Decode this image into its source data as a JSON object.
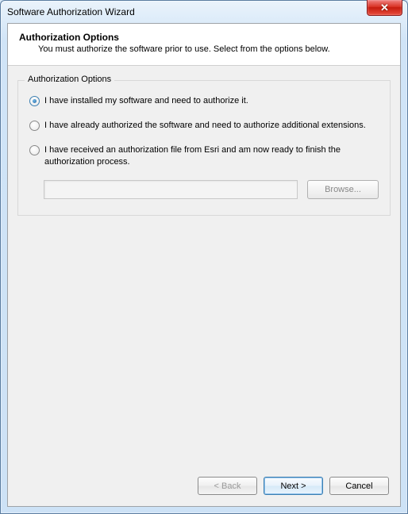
{
  "window": {
    "title": "Software Authorization Wizard"
  },
  "header": {
    "title": "Authorization Options",
    "subtitle": "You must authorize the software prior to use. Select from the options below."
  },
  "group": {
    "legend": "Authorization Options",
    "options": [
      {
        "label": "I have installed my software and need to authorize it.",
        "checked": true
      },
      {
        "label": "I have already authorized the software and need to authorize additional extensions.",
        "checked": false
      },
      {
        "label": "I have received an authorization file from Esri and am now ready to finish the authorization process.",
        "checked": false
      }
    ],
    "file_path": "",
    "browse_label": "Browse..."
  },
  "footer": {
    "back_label": "< Back",
    "next_label": "Next >",
    "cancel_label": "Cancel"
  }
}
